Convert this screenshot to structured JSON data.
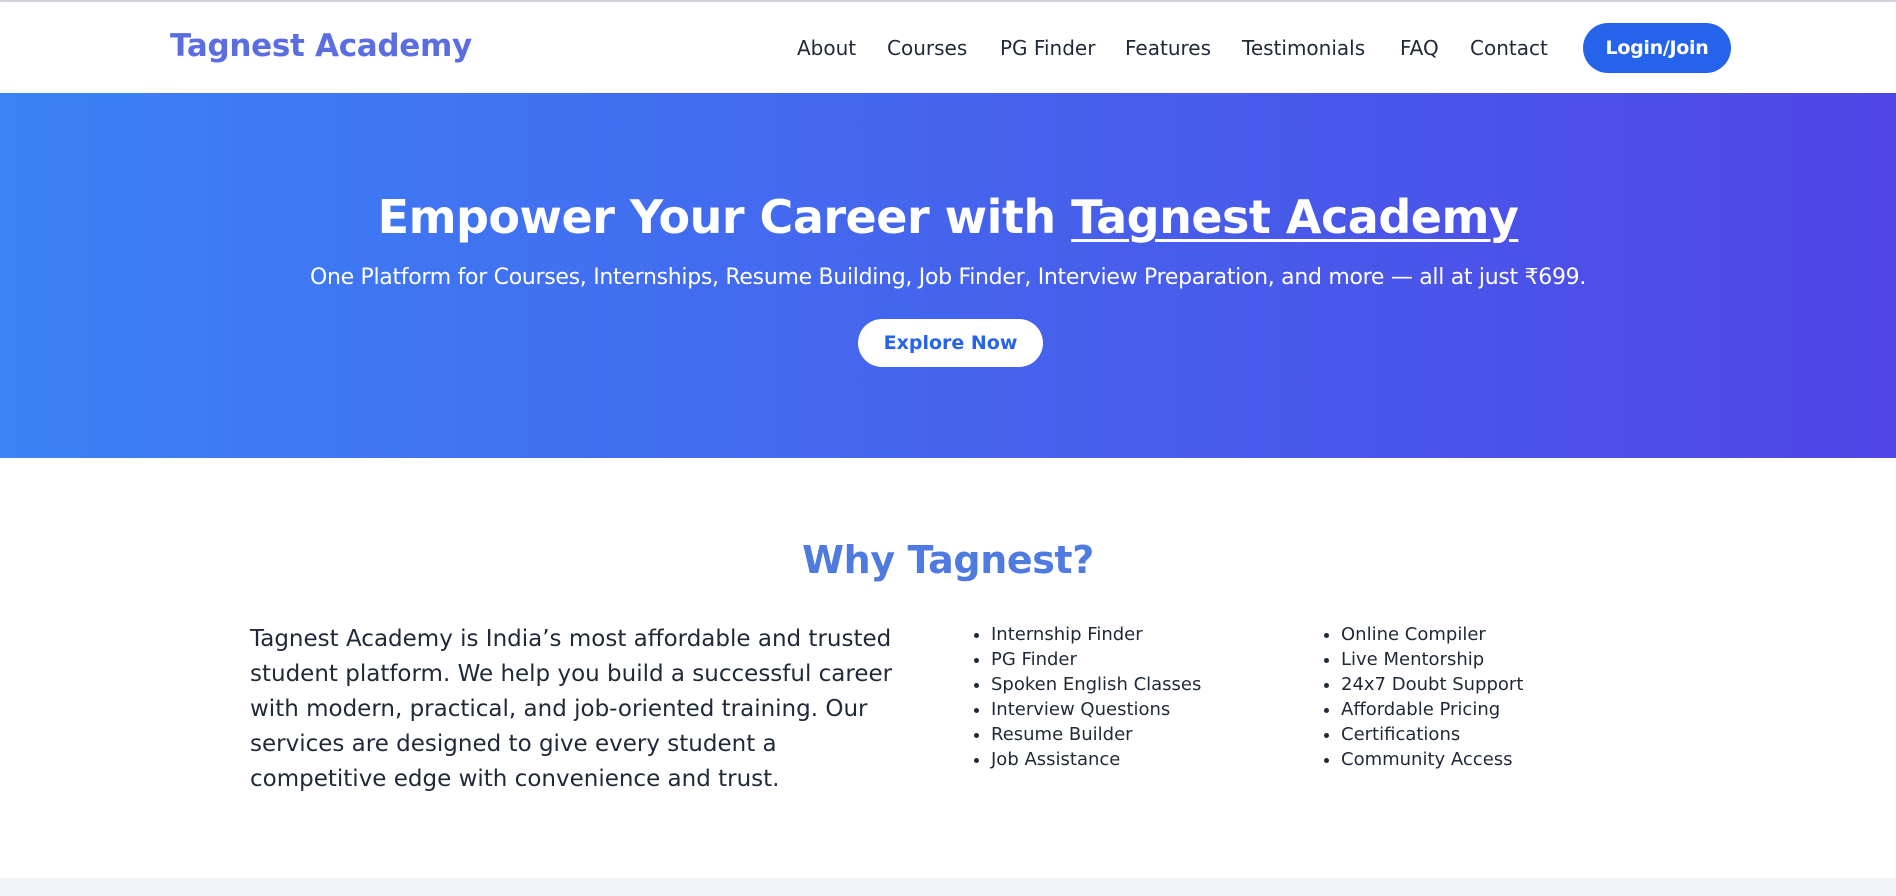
{
  "header": {
    "brand": "Tagnest Academy",
    "nav": [
      "About",
      "Courses",
      "PG Finder",
      "Features",
      "Testimonials",
      "FAQ",
      "Contact"
    ],
    "login_label": "Login/Join"
  },
  "hero": {
    "title_prefix": "Empower Your Career with ",
    "title_highlight": "Tagnest Academy",
    "subtitle": "One Platform for Courses, Internships, Resume Building, Job Finder, Interview Preparation, and more — all at just ₹699.",
    "cta_label": "Explore Now"
  },
  "why": {
    "title": "Why Tagnest?",
    "description": "Tagnest Academy is India’s most affordable and trusted student platform. We help you build a successful career with modern, practical, and job-oriented training. Our services are designed to give every student a competitive edge with convenience and trust.",
    "features_left": [
      "Internship Finder",
      "PG Finder",
      "Spoken English Classes",
      "Interview Questions",
      "Resume Builder",
      "Job Assistance"
    ],
    "features_right": [
      "Online Compiler",
      "Live Mentorship",
      "24x7 Doubt Support",
      "Affordable Pricing",
      "Certifications",
      "Community Access"
    ]
  },
  "colors": {
    "brand": "#5b6ee1",
    "primary": "#2563eb",
    "hero_gradient_start": "#3b82f6",
    "hero_gradient_end": "#4f46e5",
    "section_title": "#4f7ae0"
  }
}
